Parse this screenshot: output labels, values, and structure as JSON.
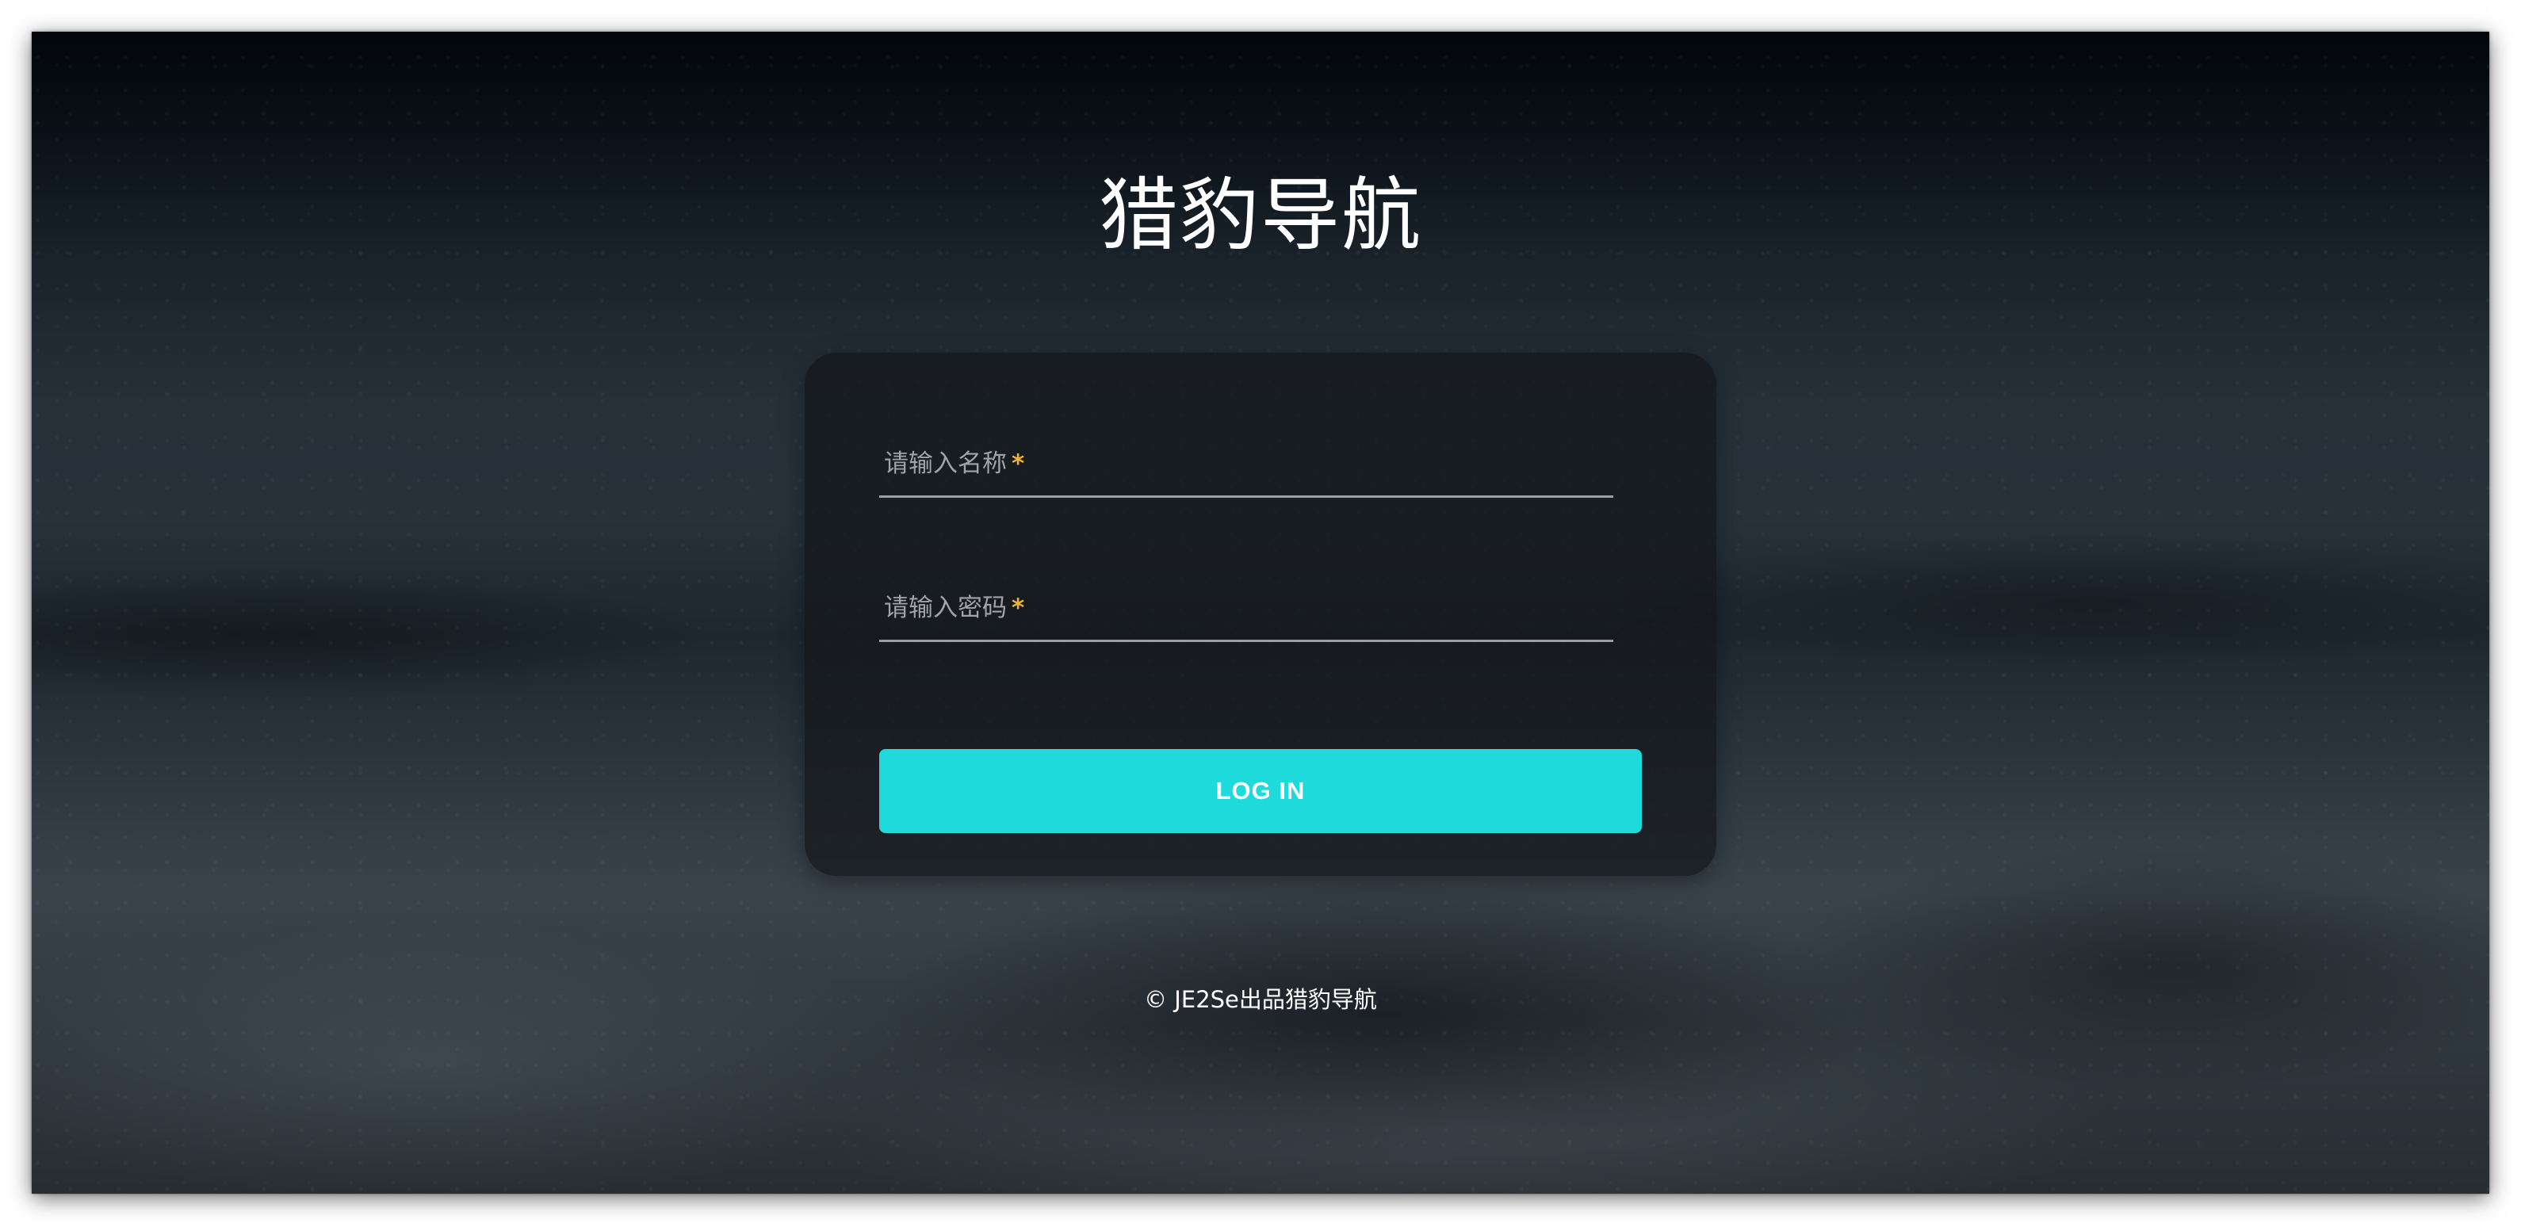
{
  "page": {
    "title": "猎豹导航"
  },
  "login_form": {
    "name_label": "请输入名称",
    "password_label": "请输入密码",
    "required_marker": "*",
    "login_button_label": "LOG IN"
  },
  "footer": {
    "copyright": "© JE2Se出品猎豹导航"
  },
  "colors": {
    "accent": "#1fdadb",
    "required_marker": "#f2b233",
    "card_background": "rgba(20,22,25,0.72)",
    "text_primary": "#ffffff",
    "field_label": "#a0a4a8"
  }
}
